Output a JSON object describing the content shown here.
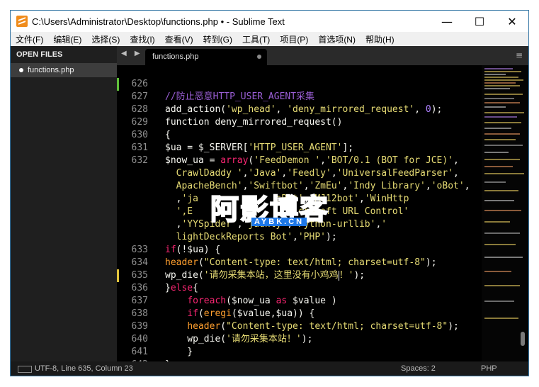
{
  "window": {
    "title": "C:\\Users\\Administrator\\Desktop\\functions.php • - Sublime Text",
    "controls": {
      "minimize": "—",
      "maximize": "☐",
      "close": "✕"
    }
  },
  "menu": [
    "文件(F)",
    "编辑(E)",
    "选择(S)",
    "查找(I)",
    "查看(V)",
    "转到(G)",
    "工具(T)",
    "项目(P)",
    "首选项(N)",
    "帮助(H)"
  ],
  "sidebar": {
    "header": "OPEN FILES",
    "files": [
      "functions.php"
    ]
  },
  "tabs": {
    "nav": "◀ ▶",
    "active": "functions.php",
    "menu_icon": "≡"
  },
  "editor": {
    "line_numbers": [
      "626",
      "627",
      "628",
      "629",
      "630",
      "631",
      "632",
      "",
      "",
      "",
      "",
      "",
      "",
      "633",
      "634",
      "635",
      "636",
      "637",
      "638",
      "639",
      "640",
      "641",
      "642"
    ],
    "current_line": "635"
  },
  "watermark": {
    "logo": "阿影博客",
    "domain": "AYBK.CN"
  },
  "status": {
    "position": "UTF-8, Line 635, Column 23",
    "indentation": "Spaces: 2",
    "syntax": "PHP"
  },
  "colors": {
    "comment": "#9b5fd6",
    "string": "#e6db74",
    "function": "#ff9f2e",
    "keyword": "#f92672",
    "number": "#ae81ff",
    "accent": "#1e78e8"
  }
}
